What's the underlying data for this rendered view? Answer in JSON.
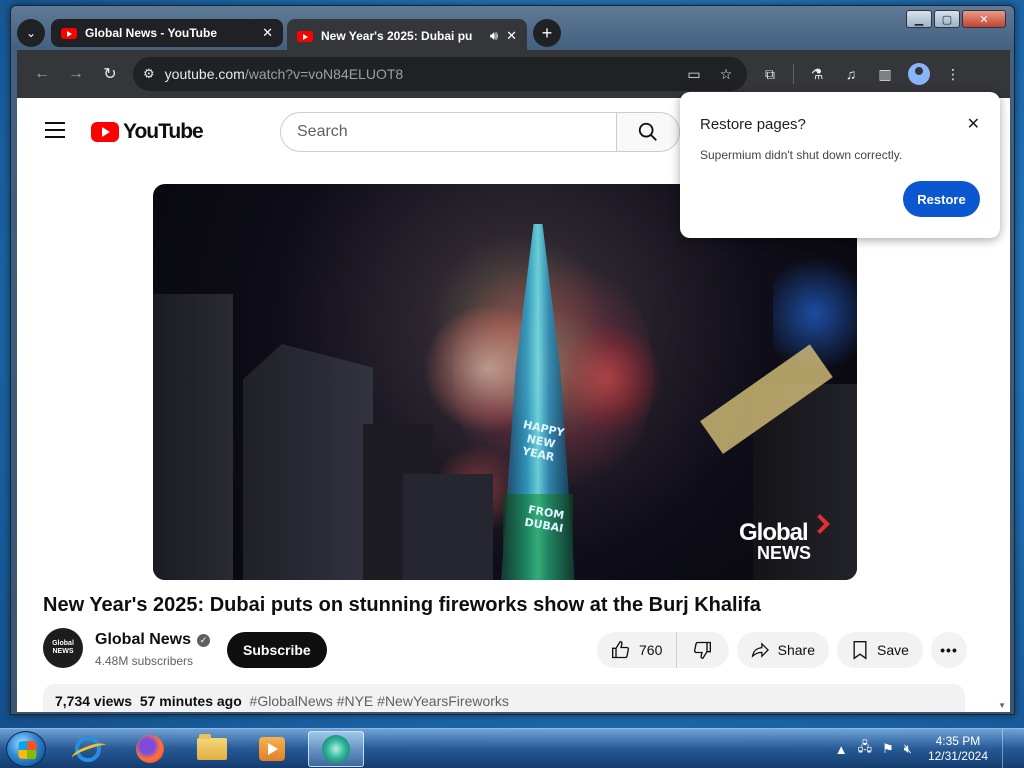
{
  "browser": {
    "tabs": [
      {
        "title": "Global News - YouTube",
        "active": false
      },
      {
        "title": "New Year's 2025: Dubai pu",
        "active": true
      }
    ],
    "url_host": "youtube.com",
    "url_path": "/watch?v=voN84ELUOT8",
    "icons": [
      "tab-list-icon",
      "back-icon",
      "forward-icon",
      "reload-icon",
      "site-info-icon",
      "cast-icon",
      "bookmark-star-icon",
      "extensions-icon",
      "labs-icon",
      "media-controls-icon",
      "side-panel-icon",
      "profile-icon",
      "menu-icon"
    ]
  },
  "youtube": {
    "logo_text": "YouTube",
    "search_placeholder": "Search",
    "video_title": "New Year's 2025: Dubai puts on stunning fireworks show at the Burj Khalifa",
    "channel_name": "Global News",
    "channel_avatar_text": "Global NEWS",
    "subscribers": "4.48M subscribers",
    "subscribe_label": "Subscribe",
    "like_count": "760",
    "share_label": "Share",
    "save_label": "Save",
    "more_label": "•••",
    "views": "7,734 views",
    "time_ago": "57 minutes ago",
    "hashtags": "#GlobalNews #NYE #NewYearsFireworks",
    "thumbnail": {
      "tower_text_1": "HAPPY NEW YEAR",
      "tower_text_2": "FROM DUBAI",
      "watermark_1": "Global",
      "watermark_2": "NEWS"
    }
  },
  "restore_popup": {
    "title": "Restore pages?",
    "message": "Supermium didn't shut down correctly.",
    "button": "Restore"
  },
  "taskbar": {
    "time": "4:35 PM",
    "date": "12/31/2024",
    "apps": [
      "internet-explorer-icon",
      "firefox-icon",
      "file-explorer-icon",
      "media-player-icon",
      "supermium-icon"
    ]
  },
  "colors": {
    "youtube_red": "#ff0000",
    "restore_blue": "#0b57d0",
    "browser_dark": "#35363a"
  }
}
